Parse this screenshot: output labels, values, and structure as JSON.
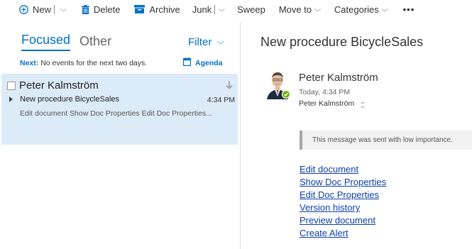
{
  "toolbar": {
    "new_label": "New",
    "delete_label": "Delete",
    "archive_label": "Archive",
    "junk_label": "Junk",
    "sweep_label": "Sweep",
    "move_to_label": "Move to",
    "categories_label": "Categories",
    "more_label": "•••"
  },
  "inbox": {
    "tabs": {
      "focused": "Focused",
      "other": "Other"
    },
    "filter_label": "Filter",
    "next_label": "Next:",
    "next_text": "No events for the next two days.",
    "agenda_label": "Agenda"
  },
  "message_list": [
    {
      "sender": "Peter Kalmström",
      "subject": "New procedure BicycleSales",
      "time": "4:34 PM",
      "preview": "Edit document Show Doc Properties Edit Doc Properties..."
    }
  ],
  "reading_pane": {
    "subject": "New procedure BicycleSales",
    "sender": "Peter Kalmström",
    "date": "Today, 4:34 PM",
    "to": "Peter Kalmström",
    "importance_note": "This message was sent with low importance.",
    "links": [
      "Edit document",
      "Show Doc Properties",
      "Edit Doc Properties",
      "Version history",
      "Preview document",
      "Create Alert"
    ]
  },
  "colors": {
    "accent": "#0072c6",
    "selected_bg": "#dcebf8",
    "link": "#0b3fa7",
    "presence_online": "#6bb700"
  },
  "icons": [
    "plus-circle-icon",
    "trash-icon",
    "archive-icon",
    "more-icon",
    "download-arrow-icon",
    "calendar-icon",
    "presence-check-icon",
    "expand-icon"
  ]
}
